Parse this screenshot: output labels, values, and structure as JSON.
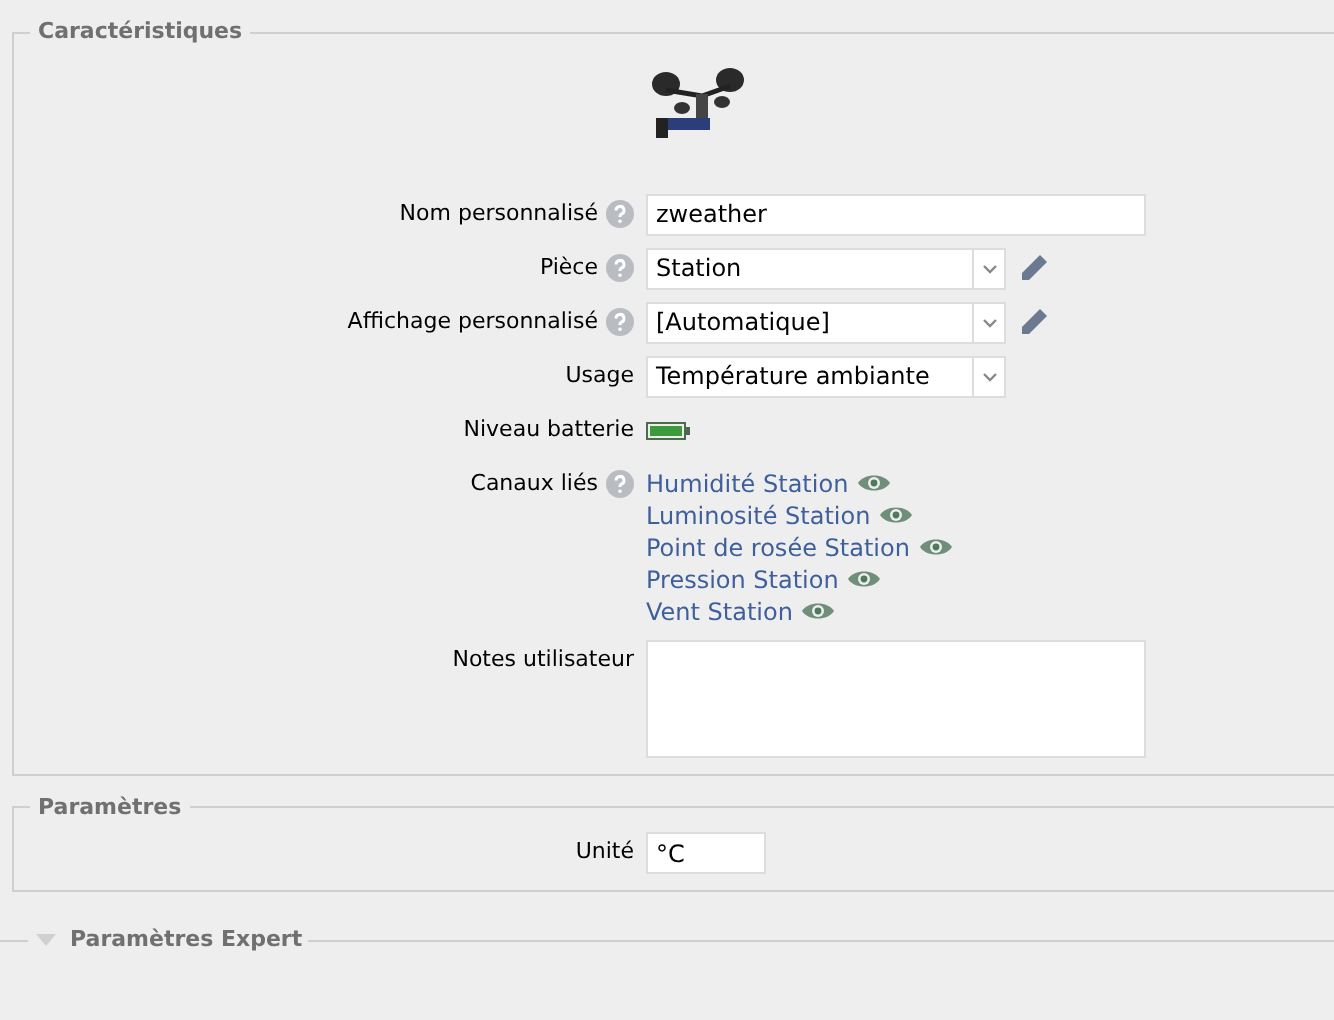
{
  "sections": [
    {
      "title": "Caractéristiques",
      "expanded": true,
      "rows": [
        {
          "kind": "image"
        },
        {
          "kind": "text",
          "label": "Nom personnalisé",
          "help": true,
          "value": "zweather"
        },
        {
          "kind": "select",
          "label": "Pièce",
          "help": true,
          "value": "Station",
          "editable": true
        },
        {
          "kind": "select",
          "label": "Affichage personnalisé",
          "help": true,
          "value": "[Automatique]",
          "editable": true
        },
        {
          "kind": "select",
          "label": "Usage",
          "help": false,
          "value": "Température ambiante",
          "editable": false
        },
        {
          "kind": "battery",
          "label": "Niveau batterie",
          "help": false,
          "level": 1
        },
        {
          "kind": "links",
          "label": "Canaux liés",
          "help": true,
          "links": [
            "Humidité Station",
            "Luminosité Station",
            "Point de rosée Station",
            "Pression Station",
            "Vent Station"
          ]
        },
        {
          "kind": "textarea",
          "label": "Notes utilisateur",
          "help": false
        }
      ]
    },
    {
      "title": "Paramètres",
      "expanded": true,
      "rows": [
        {
          "kind": "short",
          "label": "Unité",
          "help": false,
          "value": "°C"
        }
      ]
    },
    {
      "title": "Paramètres Expert",
      "expanded": false
    }
  ]
}
